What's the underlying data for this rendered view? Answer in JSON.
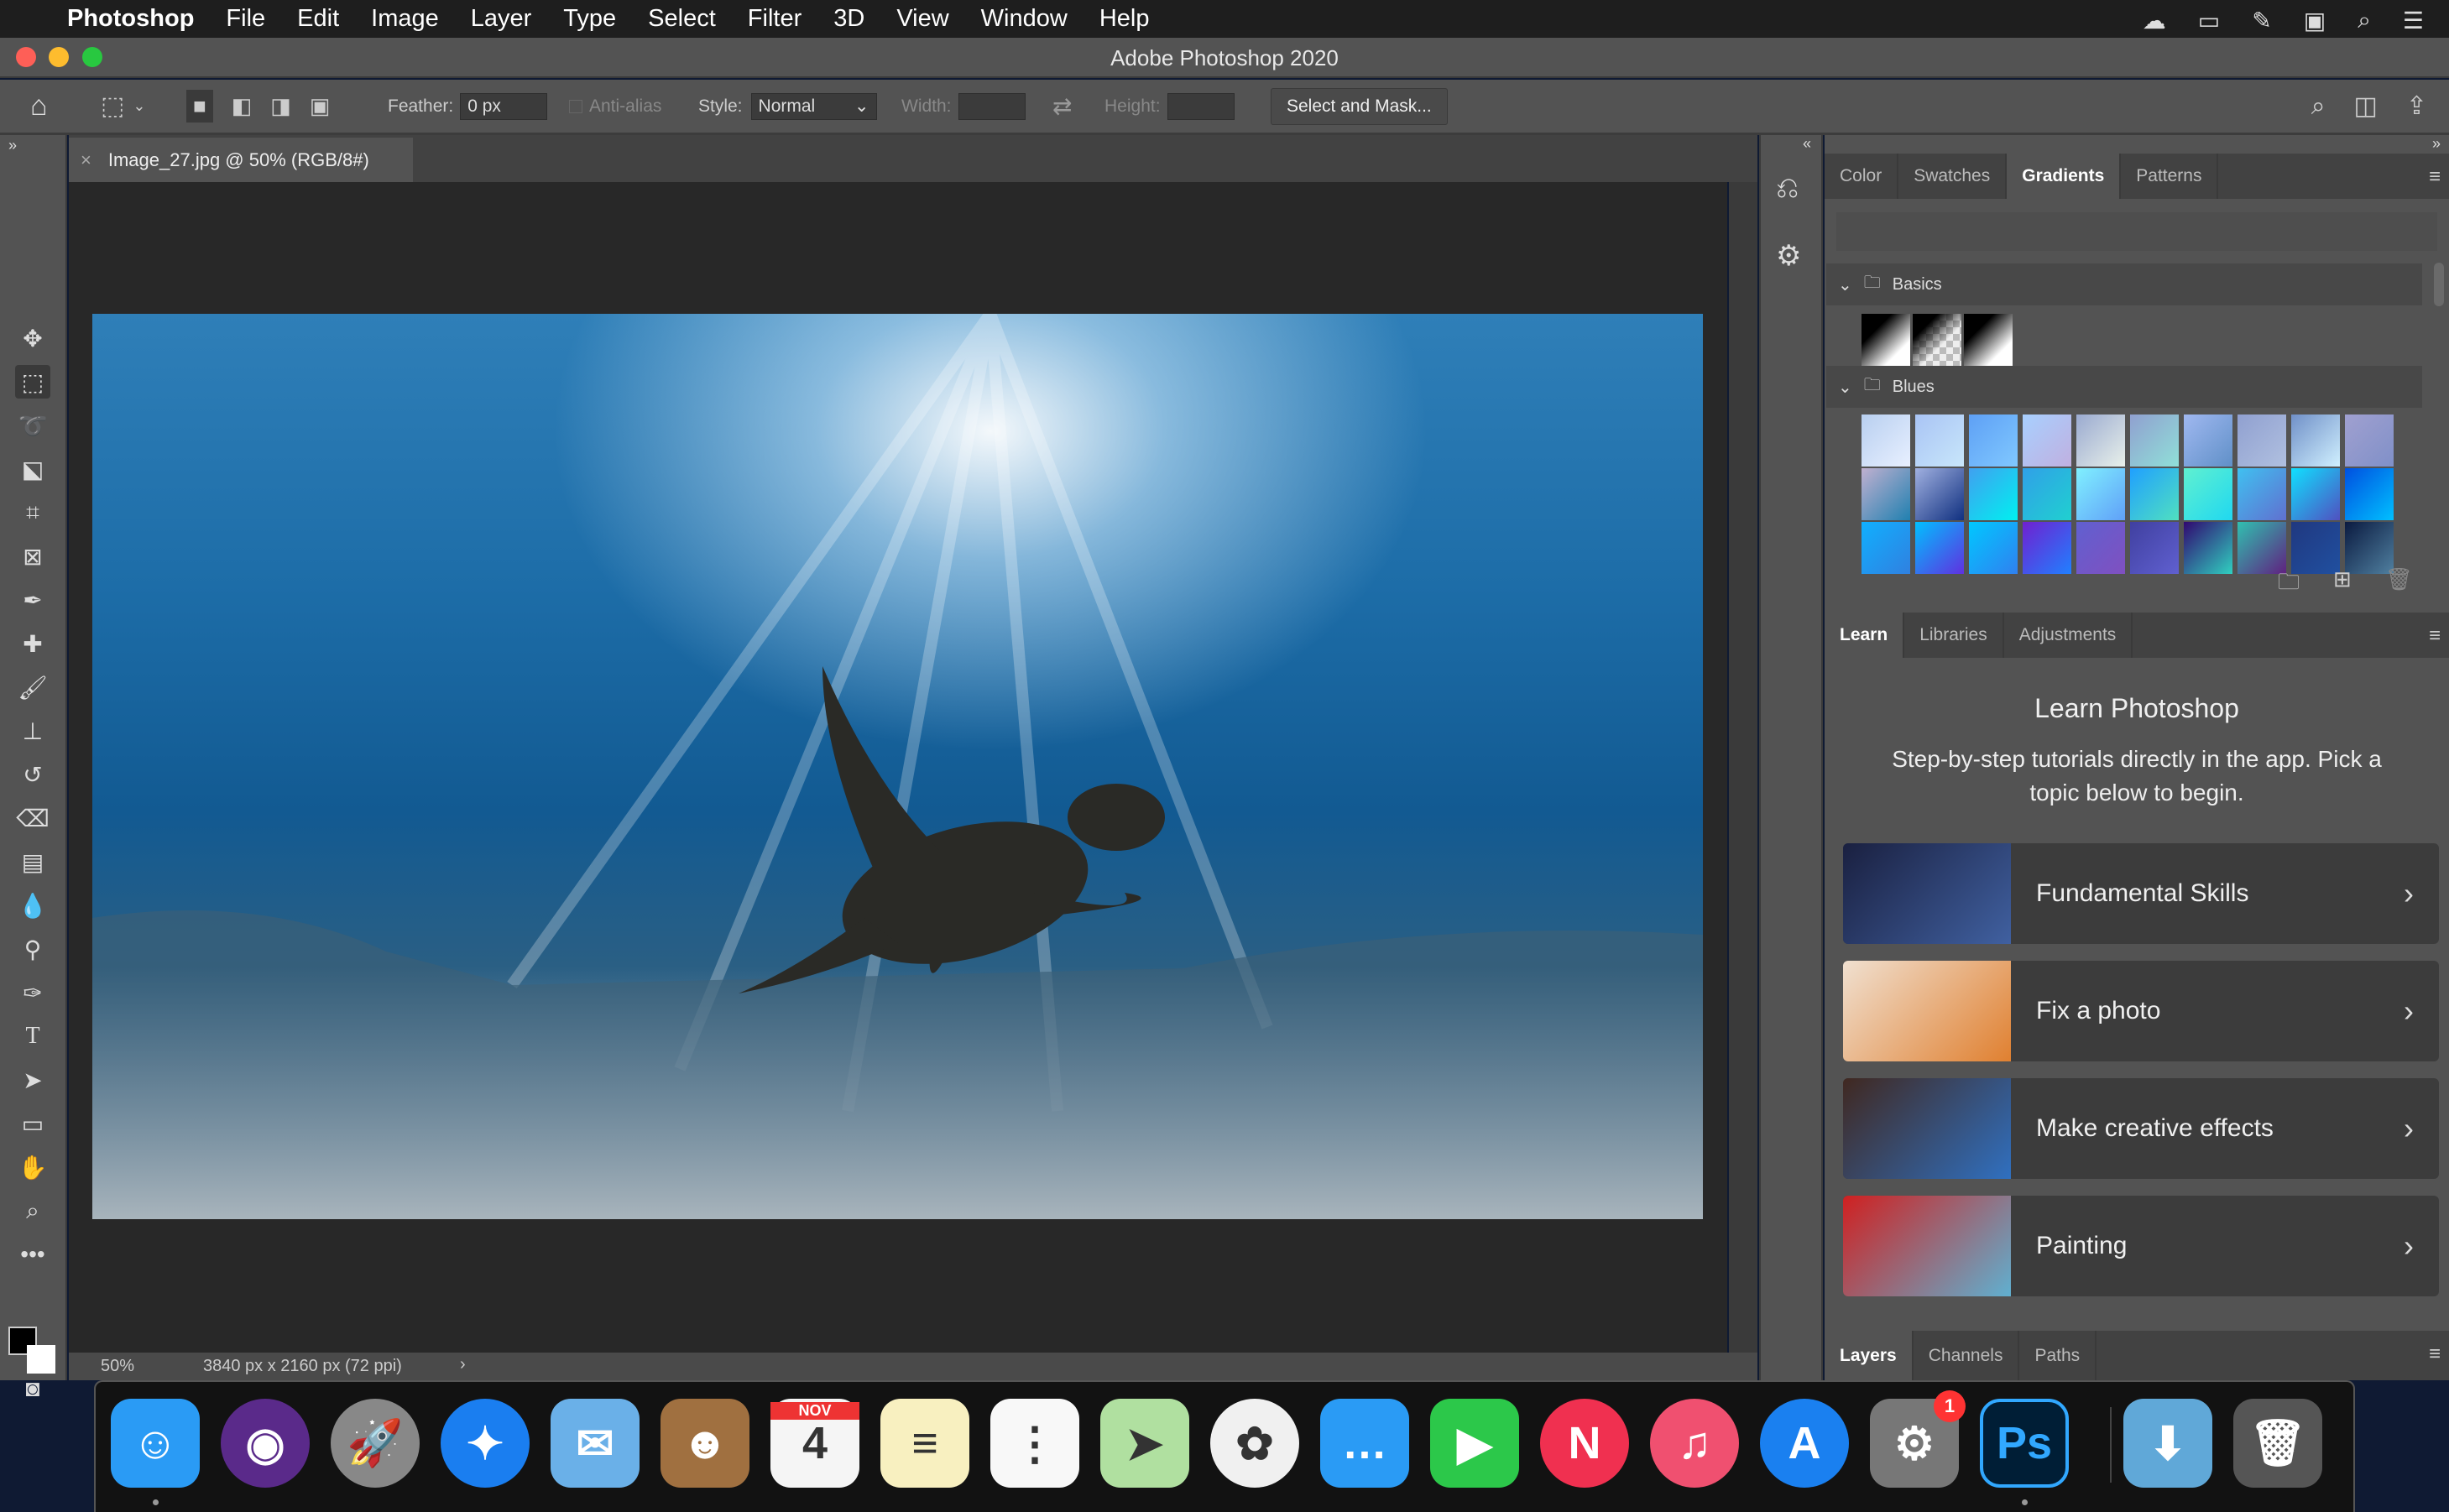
{
  "menubar": {
    "apple": "",
    "app": "Photoshop",
    "items": [
      "File",
      "Edit",
      "Image",
      "Layer",
      "Type",
      "Select",
      "Filter",
      "3D",
      "View",
      "Window",
      "Help"
    ],
    "status_icons": [
      "creative-cloud-icon",
      "notification-icon",
      "pen-icon",
      "display-icon",
      "search-icon",
      "control-center-icon"
    ]
  },
  "window": {
    "title": "Adobe Photoshop 2020"
  },
  "options": {
    "feather_label": "Feather:",
    "feather_value": "0 px",
    "antialias_label": "Anti-alias",
    "style_label": "Style:",
    "style_value": "Normal",
    "width_label": "Width:",
    "height_label": "Height:",
    "select_mask": "Select and Mask..."
  },
  "document": {
    "tab_title": "Image_27.jpg @ 50% (RGB/8#)",
    "zoom": "50%",
    "dimensions": "3840 px x 2160 px (72 ppi)"
  },
  "tools": [
    "move",
    "rectangular-marquee",
    "lasso",
    "object-selection",
    "crop",
    "frame",
    "eyedropper",
    "healing-brush",
    "brush",
    "clone-stamp",
    "history-brush",
    "eraser",
    "gradient",
    "blur",
    "dodge",
    "pen",
    "type",
    "path-selection",
    "rectangle",
    "hand",
    "zoom",
    "more"
  ],
  "panels": {
    "top_tabs": [
      "Color",
      "Swatches",
      "Gradients",
      "Patterns"
    ],
    "gradient_groups": [
      {
        "name": "Basics"
      },
      {
        "name": "Blues"
      }
    ],
    "basics": [
      [
        "#000",
        "#fff"
      ],
      [
        "#000",
        "#bbb"
      ],
      [
        "#000",
        "#fff"
      ]
    ],
    "blues": [
      [
        "#b8cff0",
        "#e8f0ff"
      ],
      [
        "#a9c4f5",
        "#c8e6fa"
      ],
      [
        "#5ea0f5",
        "#80c8ff"
      ],
      [
        "#a8d0ff",
        "#c0b0e0"
      ],
      [
        "#9aaad0",
        "#e8f0ea"
      ],
      [
        "#90a0d0",
        "#90e0d8"
      ],
      [
        "#a0b8f0",
        "#6090c8"
      ],
      [
        "#90a0d0",
        "#b0c0e0"
      ],
      [
        "#7090c8",
        "#d0f0ff"
      ],
      [
        "#a0a0d0",
        "#8090c8"
      ],
      [
        "#c0b0d0",
        "#2080b0"
      ],
      [
        "#a0b0e0",
        "#103080"
      ],
      [
        "#40a0f0",
        "#00f0f0"
      ],
      [
        "#30a0e8",
        "#20d0d0"
      ],
      [
        "#80f0ff",
        "#60a0f8"
      ],
      [
        "#20a0ff",
        "#50e0c0"
      ],
      [
        "#60f0d0",
        "#20d8f0"
      ],
      [
        "#40c0f0",
        "#6070d0"
      ],
      [
        "#10e0ff",
        "#5050c0"
      ],
      [
        "#0050e0",
        "#00c0ff"
      ],
      [
        "#10b0ff",
        "#3080e0"
      ],
      [
        "#00c0ff",
        "#6030e0"
      ],
      [
        "#00c8ff",
        "#3080f0"
      ],
      [
        "#7020d0",
        "#2080ff"
      ],
      [
        "#6060d0",
        "#8050c0"
      ],
      [
        "#4040a0",
        "#6060d0"
      ],
      [
        "#300870",
        "#30d0c0"
      ],
      [
        "#30c0b0",
        "#602080"
      ],
      [
        "#203880",
        "#2050a0"
      ],
      [
        "#0a1a40",
        "#5080a0"
      ]
    ],
    "learn_tabs": [
      "Learn",
      "Libraries",
      "Adjustments"
    ],
    "learn": {
      "title": "Learn Photoshop",
      "subtitle": "Step-by-step tutorials directly in the app. Pick a topic below to begin.",
      "cards": [
        {
          "label": "Fundamental Skills",
          "thumb": [
            "#1a2040",
            "#4060a0"
          ]
        },
        {
          "label": "Fix a photo",
          "thumb": [
            "#f0e0d0",
            "#e08030"
          ]
        },
        {
          "label": "Make creative effects",
          "thumb": [
            "#402820",
            "#3070c0"
          ]
        },
        {
          "label": "Painting",
          "thumb": [
            "#d02020",
            "#60b0d0"
          ]
        }
      ]
    },
    "bottom_tabs": [
      "Layers",
      "Channels",
      "Paths"
    ]
  },
  "dock": {
    "apps": [
      {
        "name": "Finder",
        "color": "#2a9bf5",
        "glyph": "☺"
      },
      {
        "name": "Siri",
        "color": "#5a2a8a",
        "glyph": "◉"
      },
      {
        "name": "Launchpad",
        "color": "#888",
        "glyph": "🚀"
      },
      {
        "name": "Safari",
        "color": "#1a7ef0",
        "glyph": "✦"
      },
      {
        "name": "Mail",
        "color": "#6ab0e8",
        "glyph": "✉"
      },
      {
        "name": "Contacts",
        "color": "#a07040",
        "glyph": "☻"
      },
      {
        "name": "Calendar",
        "color": "#f5f5f5",
        "glyph": "4",
        "month": "NOV"
      },
      {
        "name": "Notes",
        "color": "#f8f0c0",
        "glyph": "≡"
      },
      {
        "name": "Reminders",
        "color": "#f8f8f8",
        "glyph": "⋮"
      },
      {
        "name": "Maps",
        "color": "#b0e0a0",
        "glyph": "➤"
      },
      {
        "name": "Photos",
        "color": "#f0f0f0",
        "glyph": "✿"
      },
      {
        "name": "Messages",
        "color": "#2a9bf5",
        "glyph": "…"
      },
      {
        "name": "FaceTime",
        "color": "#2cc84a",
        "glyph": "▶"
      },
      {
        "name": "News",
        "color": "#f03050",
        "glyph": "N"
      },
      {
        "name": "Music",
        "color": "#f05070",
        "glyph": "♫"
      },
      {
        "name": "App Store",
        "color": "#1a80f0",
        "glyph": "A"
      },
      {
        "name": "System Preferences",
        "color": "#777",
        "glyph": "⚙",
        "badge": "1"
      },
      {
        "name": "Photoshop",
        "color": "#001e36",
        "glyph": "Ps"
      },
      {
        "name": "Downloads",
        "color": "#60a8d8",
        "glyph": "⬇"
      },
      {
        "name": "Trash",
        "color": "#555",
        "glyph": "🗑"
      }
    ]
  }
}
